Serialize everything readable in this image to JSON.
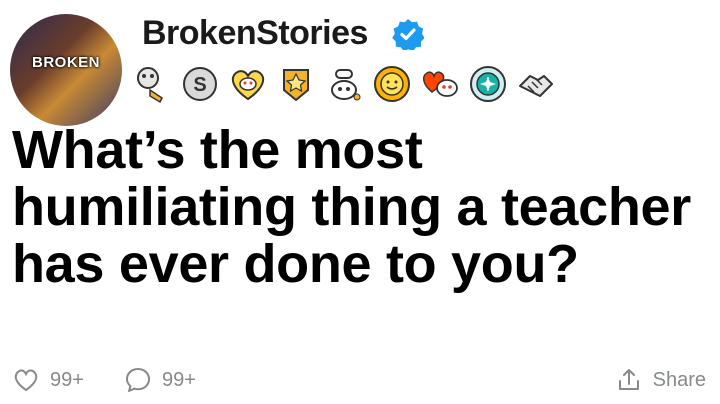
{
  "profile": {
    "avatar_text": "BROKEN",
    "username": "BrokenStories",
    "verified": true
  },
  "awards": [
    {
      "icon": "trumpet-award-icon"
    },
    {
      "icon": "silver-s-award-icon"
    },
    {
      "icon": "heart-snoo-award-icon"
    },
    {
      "icon": "gold-star-award-icon"
    },
    {
      "icon": "snoo-chef-award-icon"
    },
    {
      "icon": "sun-award-icon"
    },
    {
      "icon": "heart-eyes-snoo-award-icon"
    },
    {
      "icon": "teal-badge-award-icon"
    },
    {
      "icon": "handshake-award-icon"
    }
  ],
  "post": {
    "title": "What’s the most humiliating thing a teacher has ever done to you?"
  },
  "footer": {
    "likes": "99+",
    "comments": "99+",
    "share_label": "Share"
  },
  "colors": {
    "verified": "#1d9bf0",
    "meta": "#878a8c"
  }
}
